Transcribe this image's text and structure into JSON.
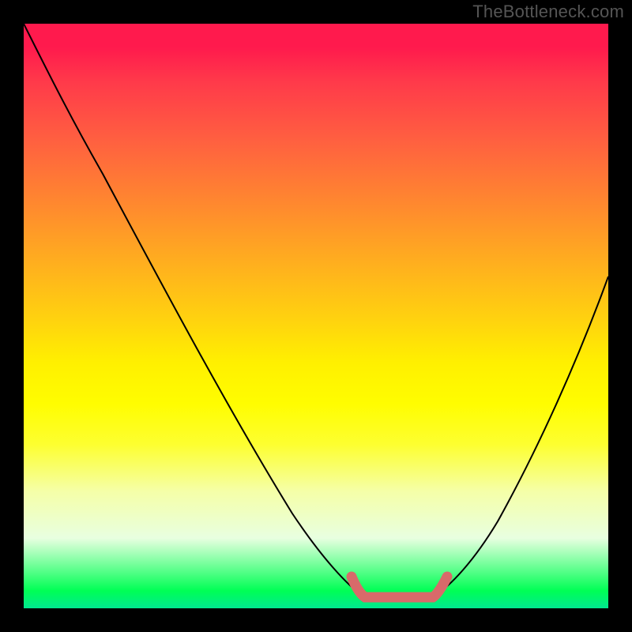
{
  "watermark": "TheBottleneck.com",
  "chart_data": {
    "type": "line",
    "title": "",
    "xlabel": "",
    "ylabel": "",
    "xlim": [
      0,
      100
    ],
    "ylim": [
      0,
      100
    ],
    "x": [
      0,
      5,
      10,
      15,
      20,
      25,
      30,
      35,
      40,
      45,
      50,
      55,
      58,
      60,
      62,
      65,
      68,
      70,
      75,
      80,
      85,
      90,
      95,
      100
    ],
    "values": [
      100,
      95,
      88,
      80,
      72,
      64,
      56,
      48,
      40,
      32,
      24,
      14,
      6,
      2,
      0,
      0,
      0,
      2,
      8,
      18,
      30,
      42,
      52,
      60
    ],
    "flat_segment": {
      "x_start": 58,
      "x_end": 70,
      "color": "#d86a6a",
      "note": "thick flat reddish band indicating optimal/bottom region of V-curve"
    },
    "gradient_background": {
      "top": "#ff1a4d",
      "middle": "#fff000",
      "bottom": "#00ff55"
    }
  }
}
